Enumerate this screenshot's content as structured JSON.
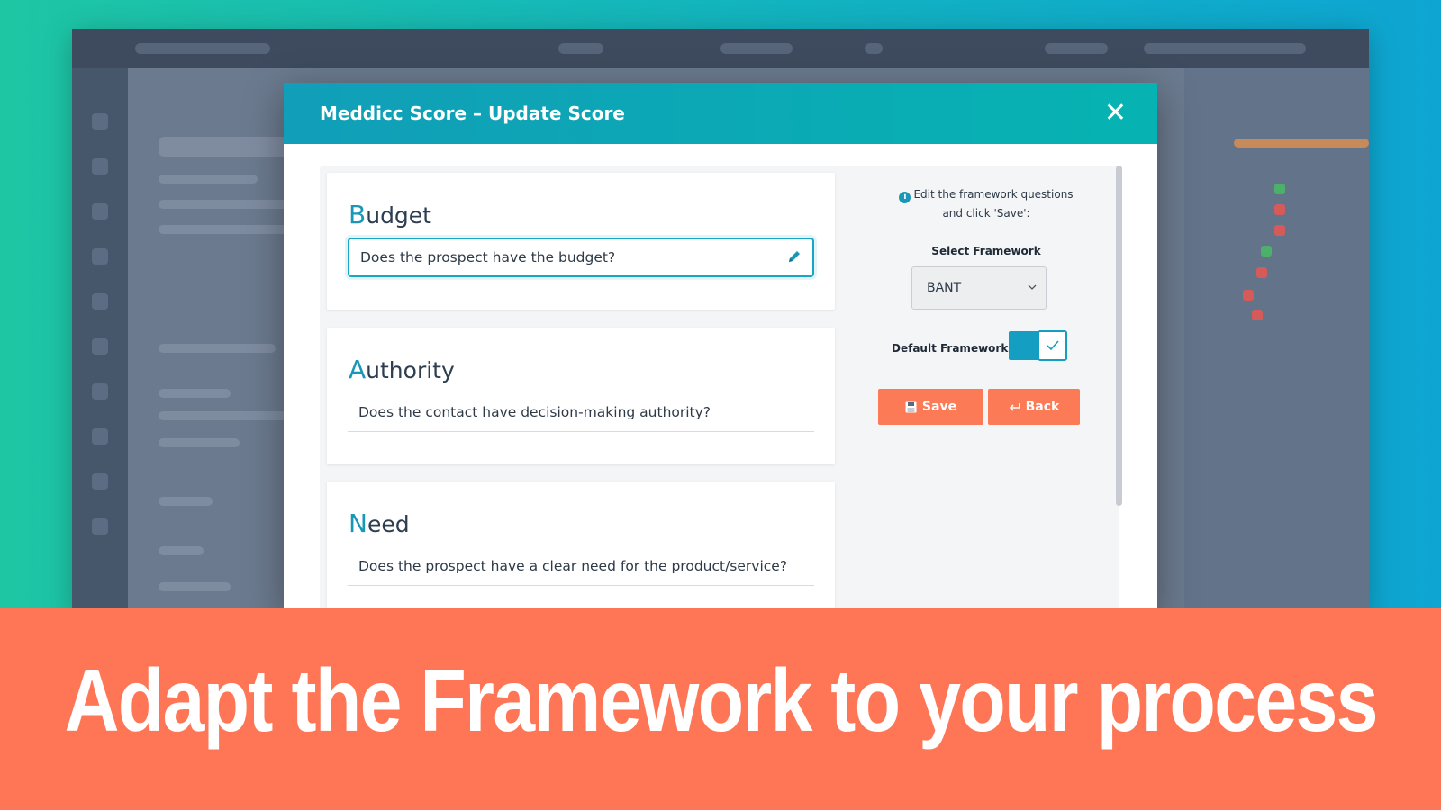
{
  "modal": {
    "title": "Meddicc Score – Update Score",
    "close_icon": "close-icon"
  },
  "cards": [
    {
      "initial": "B",
      "rest": "udget",
      "question": "Does the prospect have the budget?",
      "active": true
    },
    {
      "initial": "A",
      "rest": "uthority",
      "question": "Does the contact have decision-making authority?",
      "active": false
    },
    {
      "initial": "N",
      "rest": "eed",
      "question": "Does the prospect have a clear need for the product/service?",
      "active": false
    }
  ],
  "side_panel": {
    "info_line1": "Edit the framework questions",
    "info_line2": "and click 'Save':",
    "select_label": "Select Framework",
    "select_value": "BANT",
    "default_label": "Default Framework",
    "default_enabled": true,
    "save_label": "Save",
    "back_label": "Back"
  },
  "banner": {
    "text": "Adapt the Framework to your process"
  },
  "colors": {
    "accent": "#1a97b6",
    "button": "#fd7a56",
    "banner": "#fe7656"
  }
}
